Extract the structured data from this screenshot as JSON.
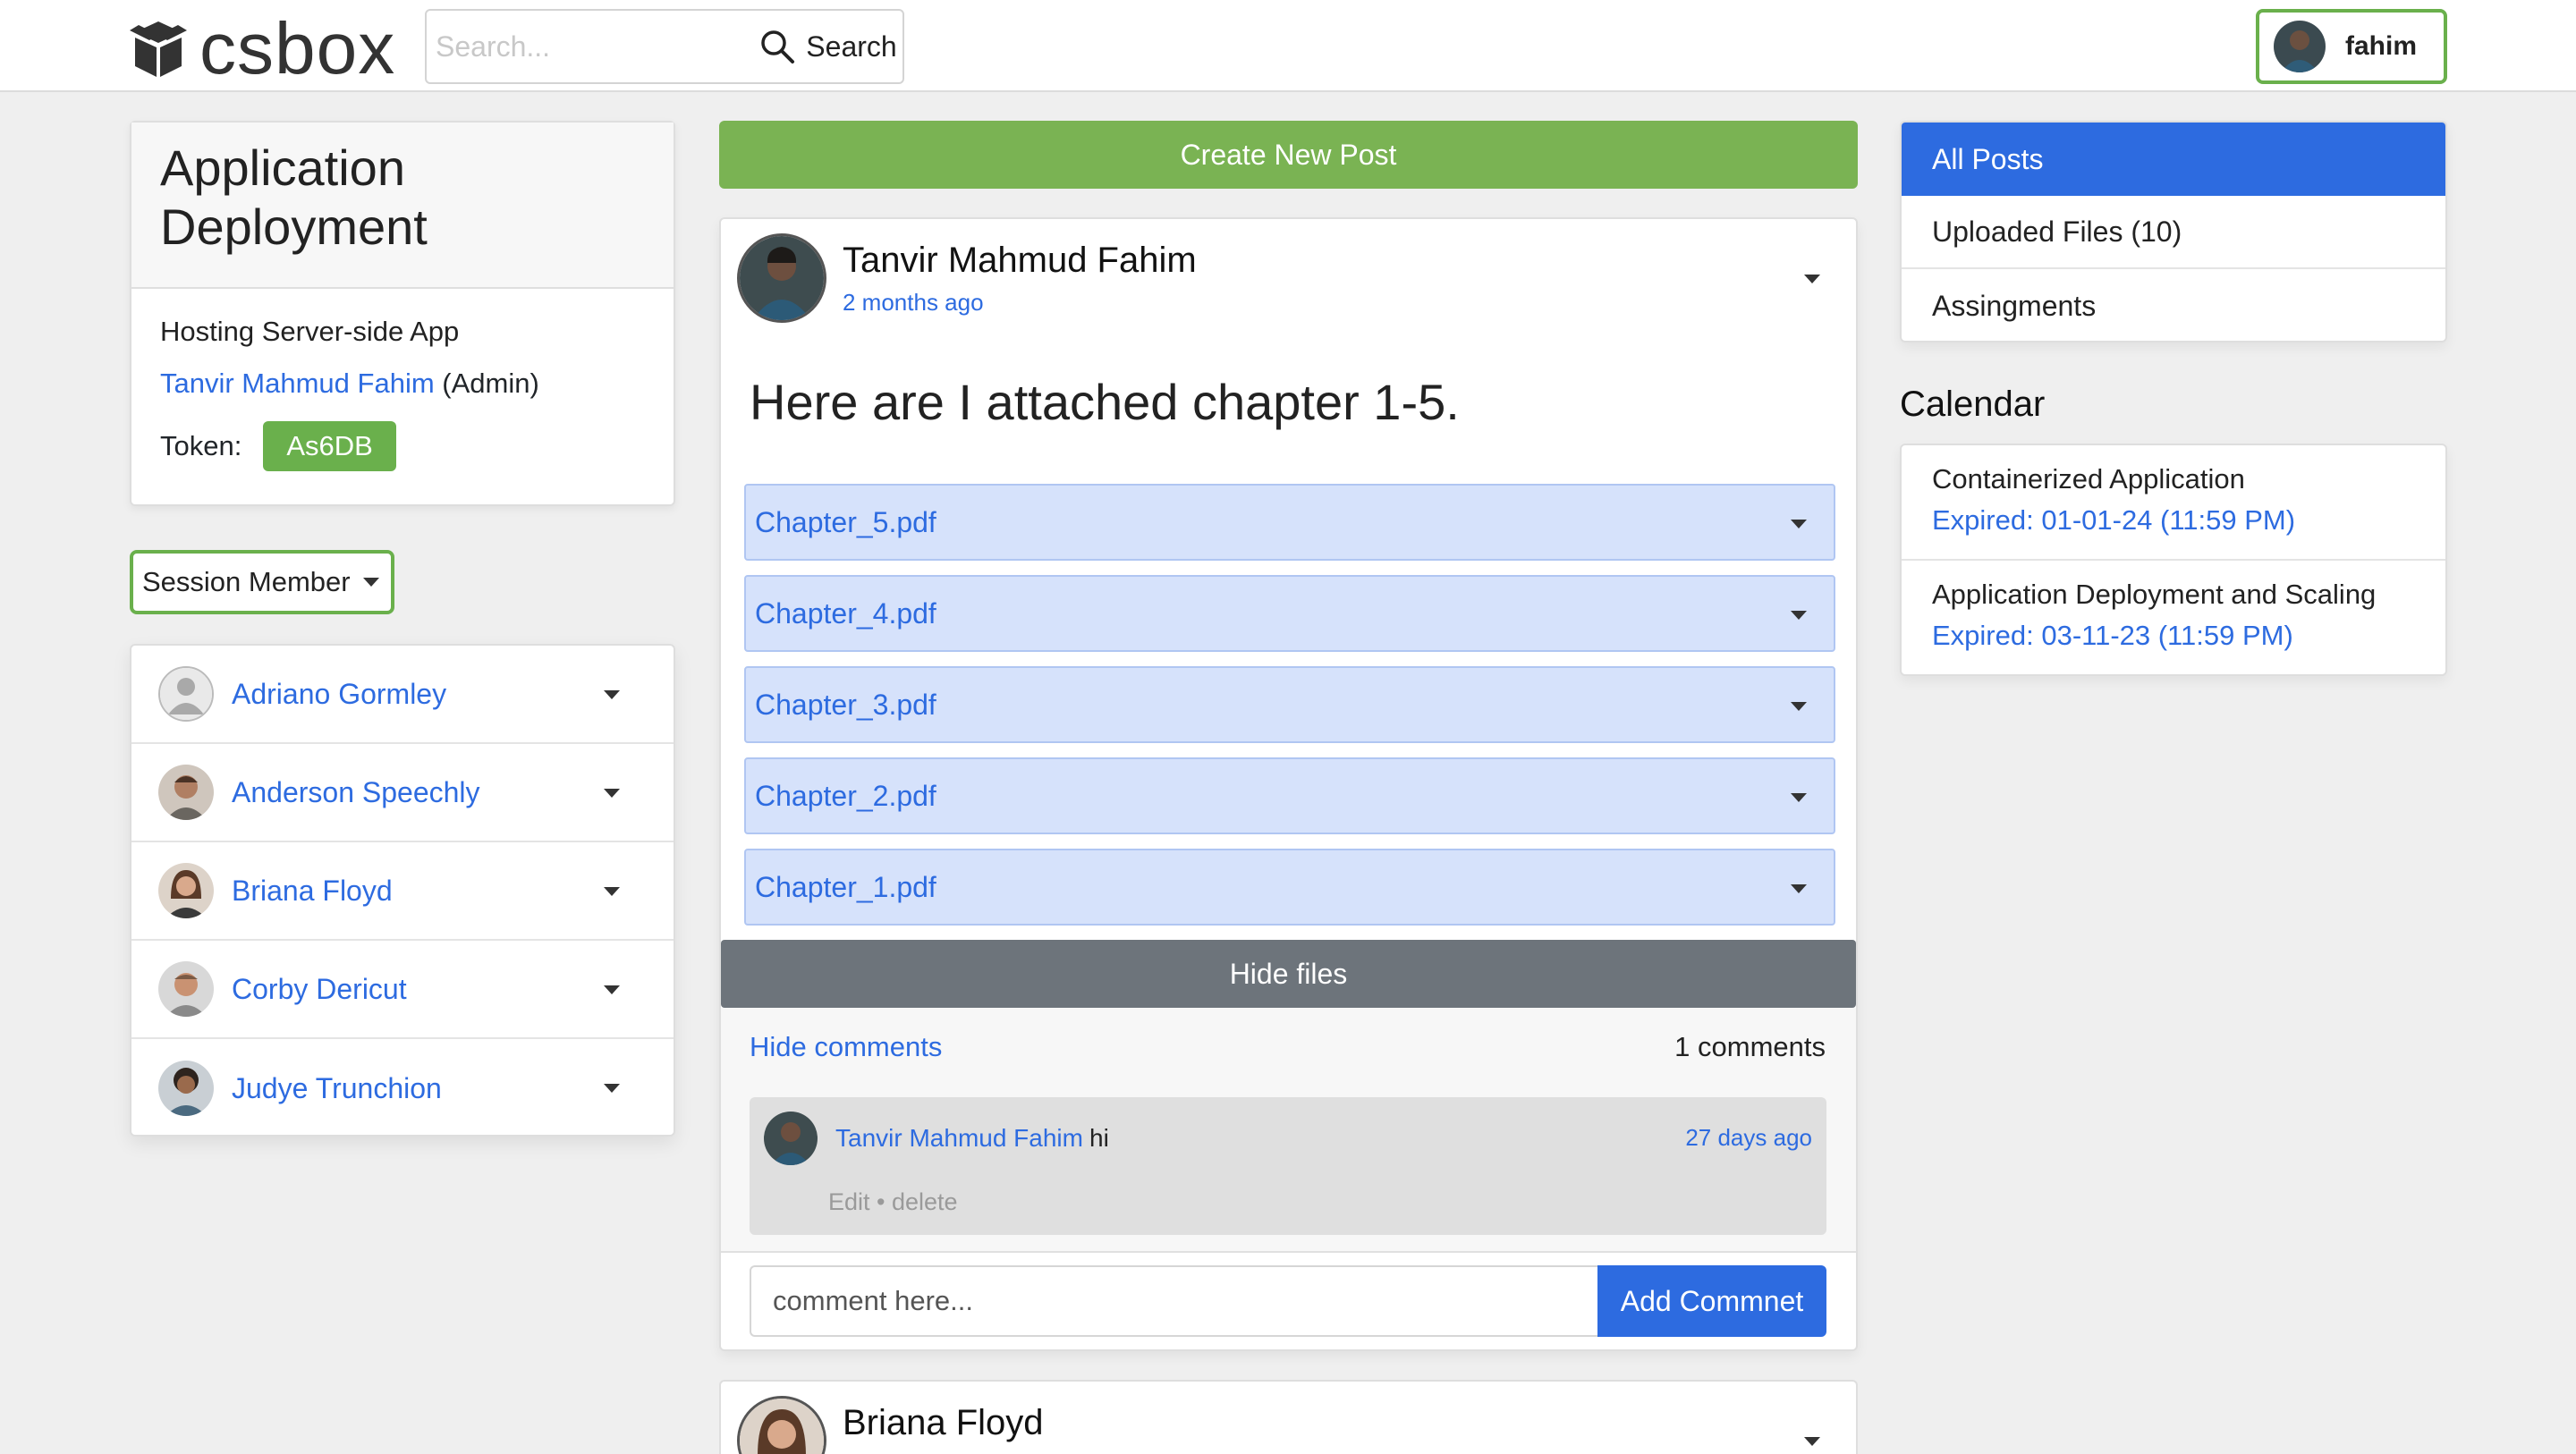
{
  "navbar": {
    "logo_text": "csbox",
    "search_placeholder": "Search...",
    "search_button": "Search",
    "user_name": "fahim"
  },
  "course": {
    "title": "Application Deployment",
    "subtitle": "Hosting Server-side App",
    "admin_name": "Tanvir Mahmud Fahim",
    "admin_role": "(Admin)",
    "token_label": "Token:",
    "token_value": "As6DB"
  },
  "session": {
    "button_label": "Session Member",
    "members": [
      {
        "name": "Adriano Gormley"
      },
      {
        "name": "Anderson Speechly"
      },
      {
        "name": "Briana Floyd"
      },
      {
        "name": "Corby Dericut"
      },
      {
        "name": "Judye Trunchion"
      }
    ]
  },
  "feed": {
    "create_button": "Create New Post",
    "post": {
      "author": "Tanvir Mahmud Fahim",
      "time": "2 months ago",
      "text": "Here are I attached chapter 1-5.",
      "files": [
        "Chapter_5.pdf",
        "Chapter_4.pdf",
        "Chapter_3.pdf",
        "Chapter_2.pdf",
        "Chapter_1.pdf"
      ],
      "hide_files": "Hide files",
      "hide_comments": "Hide comments",
      "comment_count": "1 comments",
      "comment": {
        "author": "Tanvir Mahmud Fahim",
        "text": "hi",
        "time": "27 days ago",
        "actions": "Edit • delete"
      },
      "comment_placeholder": "comment here...",
      "add_comment_button": "Add Commnet"
    },
    "next_post_author": "Briana Floyd"
  },
  "sidebar": {
    "items": [
      {
        "label": "All Posts",
        "active": true
      },
      {
        "label": "Uploaded Files (10)",
        "active": false
      },
      {
        "label": "Assingments",
        "active": false
      }
    ],
    "calendar_title": "Calendar",
    "calendar": [
      {
        "name": "Containerized Application",
        "date": "Expired: 01-01-24 (11:59 PM)"
      },
      {
        "name": "Application Deployment and Scaling",
        "date": "Expired: 03-11-23 (11:59 PM)"
      }
    ]
  },
  "colors": {
    "accent_green": "#6ab04c",
    "link_blue": "#2d6be0",
    "button_gray": "#6d747b"
  }
}
